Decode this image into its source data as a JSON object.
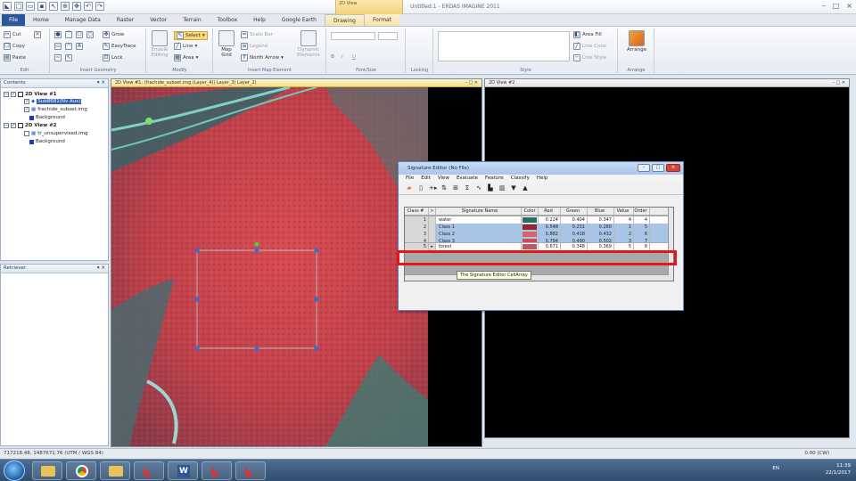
{
  "window": {
    "title": "Untitled:1 - ERDAS IMAGINE 2011",
    "context_tab": "2D View",
    "min": "–",
    "max": "□",
    "close": "×"
  },
  "tabs": [
    "File",
    "Home",
    "Manage Data",
    "Raster",
    "Vector",
    "Terrain",
    "Toolbox",
    "Help",
    "Google Earth",
    "Drawing",
    "Format"
  ],
  "ribbon": {
    "edit": {
      "cut": "Cut",
      "copy": "Copy",
      "paste": "Paste",
      "label": "Edit"
    },
    "insert": {
      "grow": "Grow",
      "easytrace": "EasyTrace",
      "lock": "Lock",
      "label": "Insert Geometry"
    },
    "modify": {
      "enable": "Enable Editing",
      "select": "Select",
      "line": "Line",
      "area": "Area",
      "label": "Modify"
    },
    "mapel": {
      "mapgrid": "Map Grid",
      "scalebar": "Scale Bar",
      "legend": "Legend",
      "north": "North Arrow",
      "dynamic": "Dynamic Elements",
      "label": "Insert Map Element"
    },
    "font": {
      "bold": "B",
      "italic": "I",
      "underline": "U",
      "label": "Font/Size"
    },
    "locking": {
      "label": "Locking"
    },
    "style": {
      "areafill": "Area Fill",
      "linecolor": "Line Color",
      "linestyle": "Line Style",
      "label": "Style"
    },
    "arrange": {
      "btn": "Arrange",
      "label": "Arrange"
    }
  },
  "contents": {
    "title": "Contents",
    "view1": "2D View #1",
    "layer_selected": "Sub8681(Nv Aus)",
    "layer_image": "frachide_subset.img",
    "bg1": "Background",
    "view2": "2D View #2",
    "layer_unsup": "tr_unsupervised.img",
    "bg2": "Background"
  },
  "retriever": {
    "title": "Retriever"
  },
  "view1": {
    "title": "2D View #1: (frachide_subset.img (Layer_4)) Layer_3) Layer_2)"
  },
  "view2": {
    "title": "2D View #2"
  },
  "sigeditor": {
    "title": "Signature Editor (No File)",
    "menu": [
      "File",
      "Edit",
      "View",
      "Evaluate",
      "Feature",
      "Classify",
      "Help"
    ],
    "columns": [
      "Class #",
      ">",
      "Signature Name",
      "Color",
      "Red",
      "Green",
      "Blue",
      "Value",
      "Order"
    ],
    "rows": [
      {
        "num": "1",
        "mark": "",
        "name": "water",
        "color": "#2f6e5c",
        "red": "0.224",
        "green": "0.404",
        "blue": "0.347",
        "value": "4",
        "order": "4"
      },
      {
        "num": "2",
        "mark": "",
        "name": "Class 1",
        "color": "#8d2a35",
        "red": "0.548",
        "green": "0.231",
        "blue": "0.260",
        "value": "1",
        "order": "5"
      },
      {
        "num": "3",
        "mark": "",
        "name": "Class 2",
        "color": "#d9626b",
        "red": "0.882",
        "green": "0.418",
        "blue": "0.432",
        "value": "2",
        "order": "6"
      },
      {
        "num": "4",
        "mark": "",
        "name": "Class 3",
        "color": "#c94c58",
        "red": "0.794",
        "green": "0.490",
        "blue": "0.502",
        "value": "3",
        "order": "7"
      },
      {
        "num": "5",
        "mark": "▸",
        "name": "forest",
        "color": "#b65a63",
        "red": "0.671",
        "green": "0.348",
        "blue": "0.369",
        "value": "5",
        "order": "8"
      }
    ],
    "tooltip": "The Signature Editor CellArray"
  },
  "status": {
    "coords": "717218.48, 1487671.76  (UTM / WGS 84)",
    "scale": "0.00 (CW)"
  },
  "tray": {
    "lang": "EN",
    "time": "11:39",
    "date": "22/1/2017"
  },
  "colors": {
    "accent": "#2b579a",
    "highlight": "#e8141c",
    "rowsel": "#a8c4e6"
  }
}
